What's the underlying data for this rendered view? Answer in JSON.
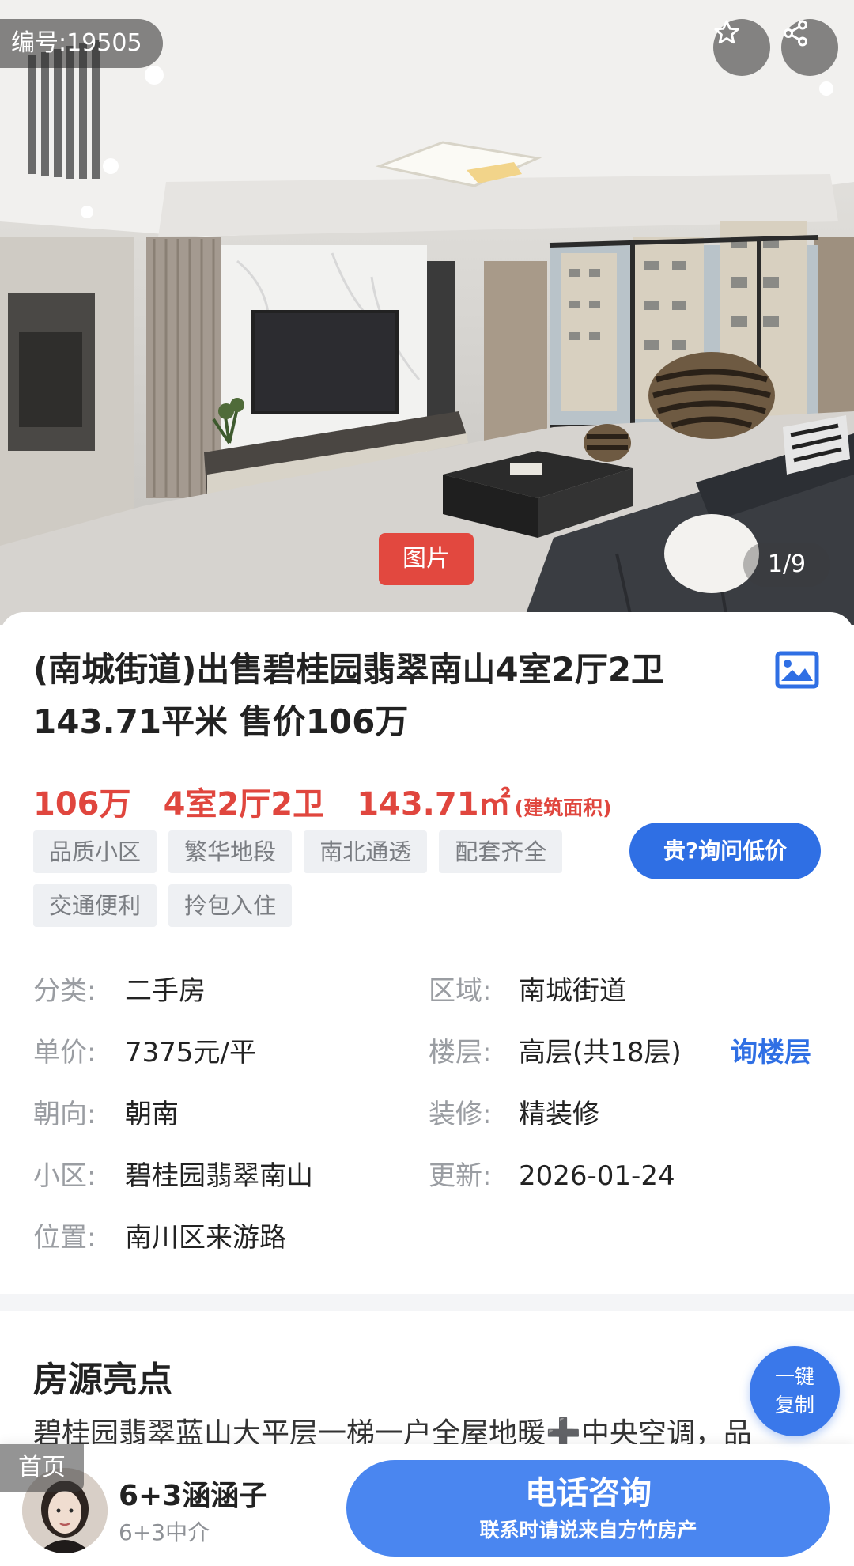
{
  "hero": {
    "listing_id": "编号:19505",
    "photo_badge": "图片",
    "photo_counter": "1/9",
    "icons": [
      "star-icon",
      "share-icon"
    ]
  },
  "listing": {
    "title": "(南城街道)出售碧桂园翡翠南山4室2厅2卫143.71平米 售价106万",
    "price": "106万",
    "layout": "4室2厅2卫",
    "area": "143.71㎡",
    "area_note": "(建筑面积)",
    "tags": [
      "品质小区",
      "繁华地段",
      "南北通透",
      "配套齐全",
      "交通便利",
      "拎包入住"
    ],
    "ask_low_price_button": "贵?询问低价",
    "details": {
      "category_label": "分类:",
      "category_value": "二手房",
      "region_label": "区域:",
      "region_value": "南城街道",
      "unit_price_label": "单价:",
      "unit_price_value": "7375元/平",
      "floor_label": "楼层:",
      "floor_value": "高层(共18层)",
      "ask_floor_link": "询楼层",
      "orientation_label": "朝向:",
      "orientation_value": "朝南",
      "decoration_label": "装修:",
      "decoration_value": "精装修",
      "community_label": "小区:",
      "community_value": "碧桂园翡翠南山",
      "updated_label": "更新:",
      "updated_value": "2026-01-24",
      "location_label": "位置:",
      "location_value": "南川区来游路"
    }
  },
  "highlights": {
    "title": "房源亮点",
    "text": "碧桂园翡翠蓝山大平层一梯一户全屋地暖➕中央空调，品",
    "copy_button_line1": "一键",
    "copy_button_line2": "复制"
  },
  "bottom_bar": {
    "home_tag": "首页",
    "agent_name": "6+3涵涵子",
    "agent_org": "6+3中介",
    "call_button": "电话咨询",
    "call_sub": "联系时请说来自方竹房产"
  },
  "colors": {
    "accent_blue": "#2f6fe4",
    "price_red": "#e0463e",
    "badge_red": "#e2483f"
  }
}
